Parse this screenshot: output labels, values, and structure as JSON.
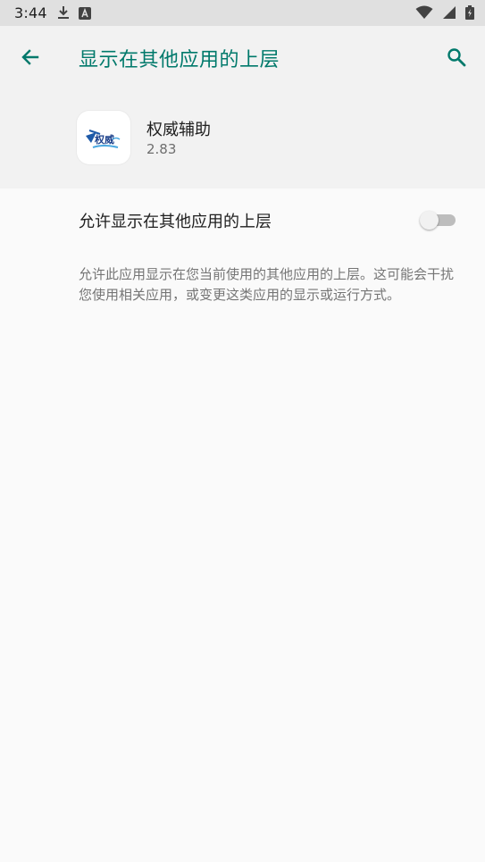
{
  "status_bar": {
    "time": "3:44",
    "left_icons": [
      "download-icon",
      "a-notification-icon"
    ],
    "right_icons": [
      "wifi-icon",
      "signal-icon",
      "battery-icon"
    ]
  },
  "appbar": {
    "title": "显示在其他应用的上层",
    "back_icon": "arrow-left-icon",
    "search_icon": "search-icon"
  },
  "app": {
    "name": "权威辅助",
    "version": "2.83",
    "icon_text": "权威"
  },
  "setting": {
    "label": "允许显示在其他应用的上层",
    "enabled": false
  },
  "description": "允许此应用显示在您当前使用的其他应用的上层。这可能会干扰您使用相关应用，或变更这类应用的显示或运行方式。",
  "colors": {
    "accent": "#00796b",
    "status_bar": "#e0e0e0",
    "header_bg": "#f2f2f2",
    "body_bg": "#fafafa"
  }
}
